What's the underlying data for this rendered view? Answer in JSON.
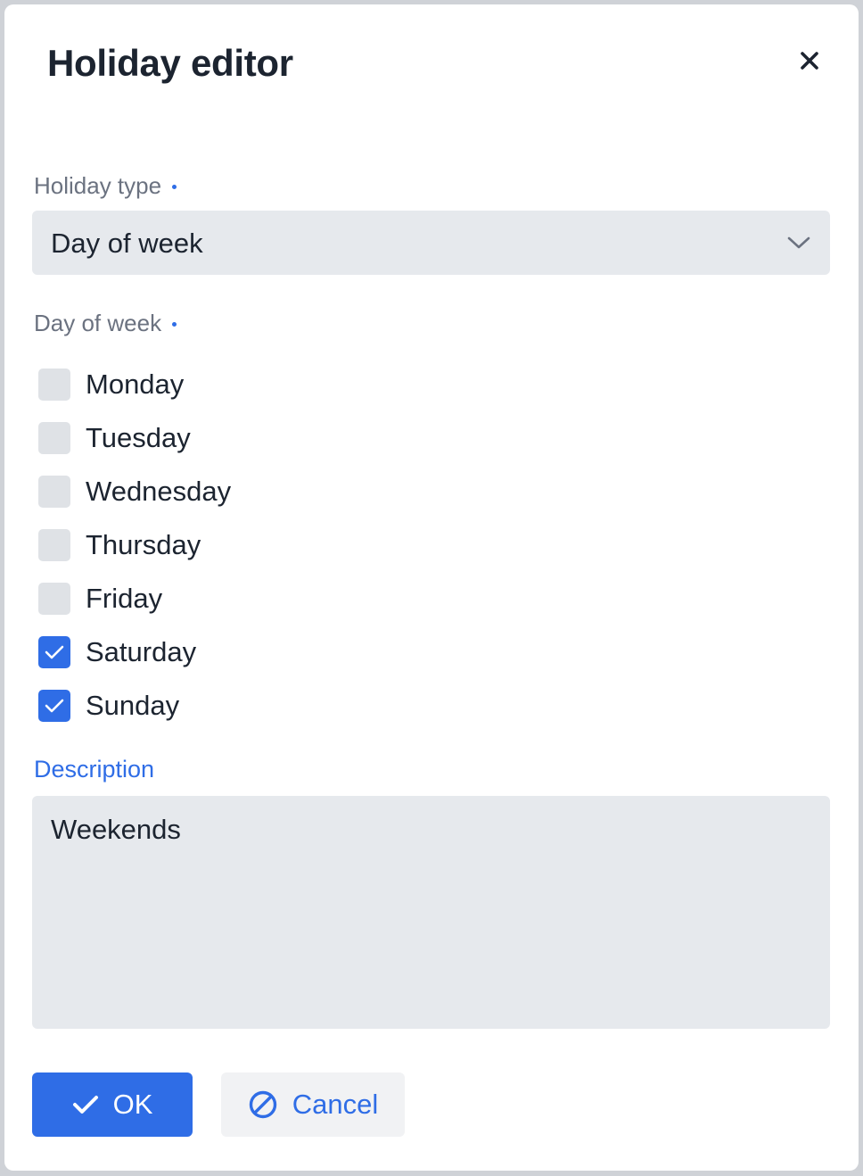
{
  "dialog": {
    "title": "Holiday editor",
    "close_icon": "close-icon"
  },
  "holiday_type": {
    "label": "Holiday type",
    "required": true,
    "value": "Day of week",
    "icon": "chevron-down-icon"
  },
  "day_of_week": {
    "label": "Day of week",
    "required": true,
    "days": [
      {
        "label": "Monday",
        "checked": false
      },
      {
        "label": "Tuesday",
        "checked": false
      },
      {
        "label": "Wednesday",
        "checked": false
      },
      {
        "label": "Thursday",
        "checked": false
      },
      {
        "label": "Friday",
        "checked": false
      },
      {
        "label": "Saturday",
        "checked": true
      },
      {
        "label": "Sunday",
        "checked": true
      }
    ]
  },
  "description": {
    "label": "Description",
    "value": "Weekends"
  },
  "actions": {
    "ok_label": "OK",
    "ok_icon": "checkmark-icon",
    "cancel_label": "Cancel",
    "cancel_icon": "cancel-circle-icon"
  },
  "colors": {
    "accent": "#2f6de6",
    "text": "#1c2430",
    "muted": "#6b7280",
    "field_bg": "#e6e9ed"
  }
}
